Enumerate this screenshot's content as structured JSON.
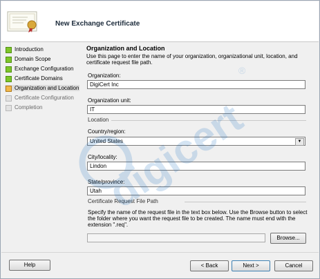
{
  "header": {
    "title": "New Exchange Certificate"
  },
  "nav": {
    "items": [
      {
        "label": "Introduction",
        "state": "done"
      },
      {
        "label": "Domain Scope",
        "state": "done"
      },
      {
        "label": "Exchange Configuration",
        "state": "done"
      },
      {
        "label": "Certificate Domains",
        "state": "done"
      },
      {
        "label": "Organization and Location",
        "state": "current"
      },
      {
        "label": "Certificate Configuration",
        "state": "todo"
      },
      {
        "label": "Completion",
        "state": "todo"
      }
    ]
  },
  "page": {
    "heading": "Organization and Location",
    "description": "Use this page to enter the name of your organization, organizational unit, location, and certificate request file path.",
    "organization_label": "Organization:",
    "organization_value": "DigiCert Inc",
    "unit_label": "Organization unit:",
    "unit_value": "IT",
    "location_section": "Location",
    "country_label": "Country/region:",
    "country_value": "United States",
    "city_label": "City/locality:",
    "city_value": "Lindon",
    "state_label": "State/province:",
    "state_value": "Utah",
    "file_section": "Certificate Request File Path",
    "file_desc": "Specify the name of the request file in the text box below. Use the Browse button to select the folder where you want the request file to be created. The name must end with the extension \".req\".",
    "file_value": "",
    "browse_label": "Browse..."
  },
  "footer": {
    "help": "Help",
    "back": "< Back",
    "next": "Next >",
    "cancel": "Cancel"
  },
  "watermark": {
    "text": "digicert",
    "reg": "®",
    "color": "#1a6fc0"
  }
}
